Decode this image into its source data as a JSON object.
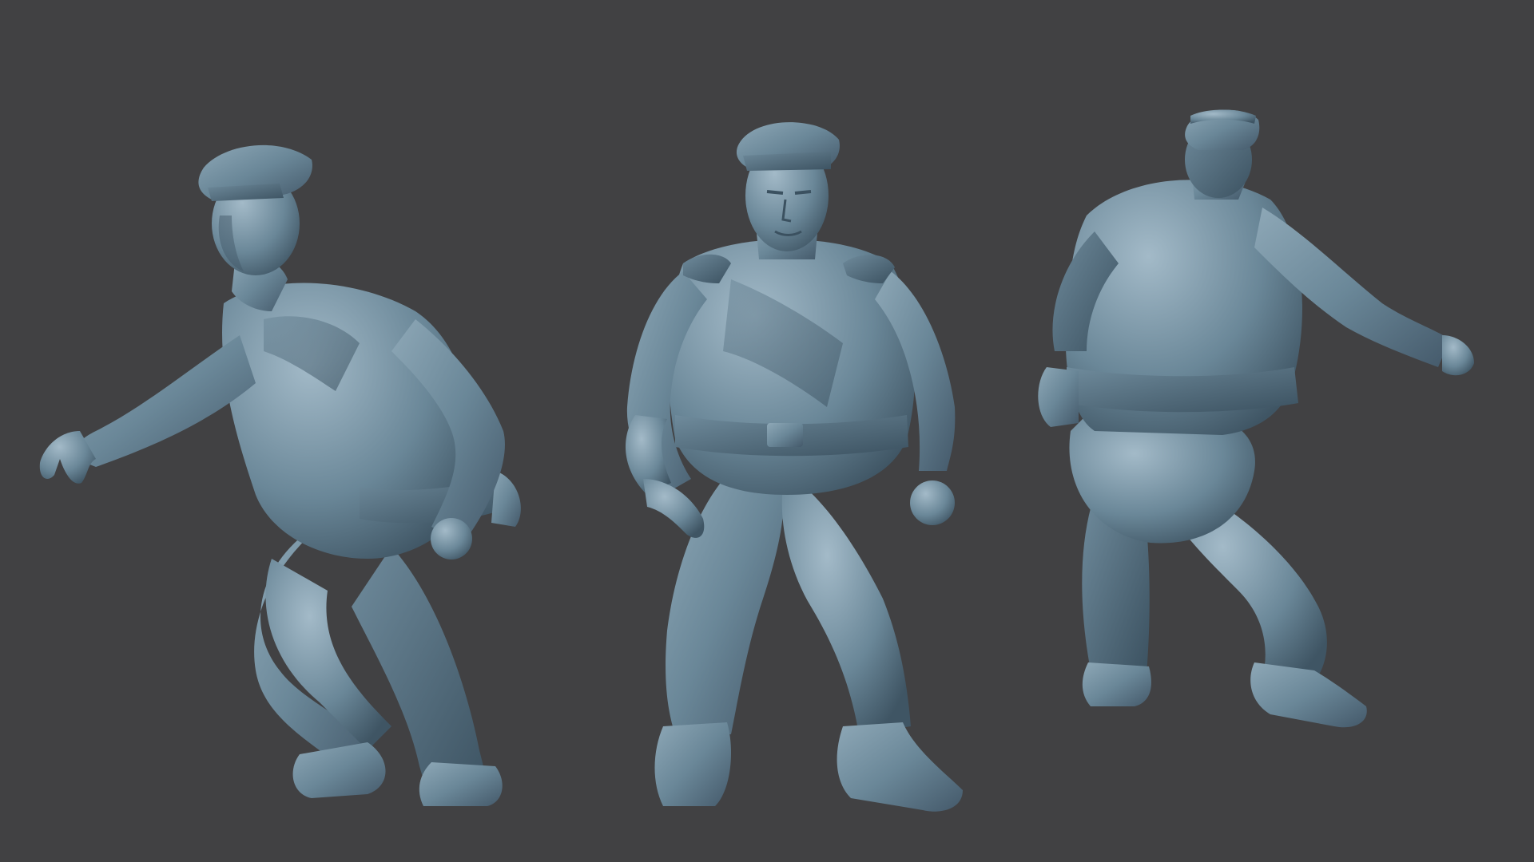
{
  "scene": {
    "background_color": "#414143",
    "material_color": "#6a8798",
    "material_shadow": "#3b5160",
    "material_highlight": "#9db6c4",
    "views": [
      {
        "view": "three-quarter-left"
      },
      {
        "view": "front"
      },
      {
        "view": "back"
      }
    ]
  }
}
